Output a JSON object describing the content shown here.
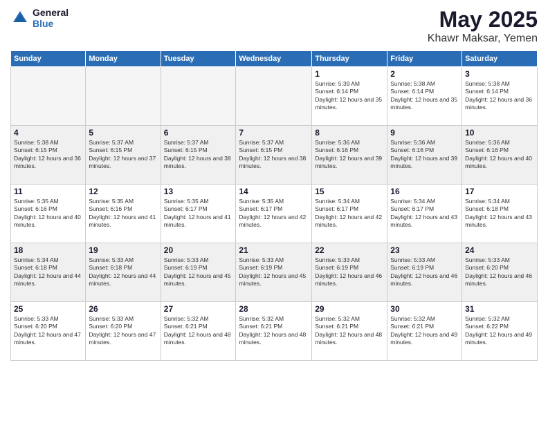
{
  "logo": {
    "general": "General",
    "blue": "Blue"
  },
  "title": "May 2025",
  "subtitle": "Khawr Maksar, Yemen",
  "days_of_week": [
    "Sunday",
    "Monday",
    "Tuesday",
    "Wednesday",
    "Thursday",
    "Friday",
    "Saturday"
  ],
  "weeks": [
    [
      {
        "day": "",
        "empty": true
      },
      {
        "day": "",
        "empty": true
      },
      {
        "day": "",
        "empty": true
      },
      {
        "day": "",
        "empty": true
      },
      {
        "day": "1",
        "sunrise": "5:39 AM",
        "sunset": "6:14 PM",
        "daylight": "12 hours and 35 minutes."
      },
      {
        "day": "2",
        "sunrise": "5:38 AM",
        "sunset": "6:14 PM",
        "daylight": "12 hours and 35 minutes."
      },
      {
        "day": "3",
        "sunrise": "5:38 AM",
        "sunset": "6:14 PM",
        "daylight": "12 hours and 36 minutes."
      }
    ],
    [
      {
        "day": "4",
        "sunrise": "5:38 AM",
        "sunset": "6:15 PM",
        "daylight": "12 hours and 36 minutes."
      },
      {
        "day": "5",
        "sunrise": "5:37 AM",
        "sunset": "6:15 PM",
        "daylight": "12 hours and 37 minutes."
      },
      {
        "day": "6",
        "sunrise": "5:37 AM",
        "sunset": "6:15 PM",
        "daylight": "12 hours and 38 minutes."
      },
      {
        "day": "7",
        "sunrise": "5:37 AM",
        "sunset": "6:15 PM",
        "daylight": "12 hours and 38 minutes."
      },
      {
        "day": "8",
        "sunrise": "5:36 AM",
        "sunset": "6:16 PM",
        "daylight": "12 hours and 39 minutes."
      },
      {
        "day": "9",
        "sunrise": "5:36 AM",
        "sunset": "6:16 PM",
        "daylight": "12 hours and 39 minutes."
      },
      {
        "day": "10",
        "sunrise": "5:36 AM",
        "sunset": "6:16 PM",
        "daylight": "12 hours and 40 minutes."
      }
    ],
    [
      {
        "day": "11",
        "sunrise": "5:35 AM",
        "sunset": "6:16 PM",
        "daylight": "12 hours and 40 minutes."
      },
      {
        "day": "12",
        "sunrise": "5:35 AM",
        "sunset": "6:16 PM",
        "daylight": "12 hours and 41 minutes."
      },
      {
        "day": "13",
        "sunrise": "5:35 AM",
        "sunset": "6:17 PM",
        "daylight": "12 hours and 41 minutes."
      },
      {
        "day": "14",
        "sunrise": "5:35 AM",
        "sunset": "6:17 PM",
        "daylight": "12 hours and 42 minutes."
      },
      {
        "day": "15",
        "sunrise": "5:34 AM",
        "sunset": "6:17 PM",
        "daylight": "12 hours and 42 minutes."
      },
      {
        "day": "16",
        "sunrise": "5:34 AM",
        "sunset": "6:17 PM",
        "daylight": "12 hours and 43 minutes."
      },
      {
        "day": "17",
        "sunrise": "5:34 AM",
        "sunset": "6:18 PM",
        "daylight": "12 hours and 43 minutes."
      }
    ],
    [
      {
        "day": "18",
        "sunrise": "5:34 AM",
        "sunset": "6:18 PM",
        "daylight": "12 hours and 44 minutes."
      },
      {
        "day": "19",
        "sunrise": "5:33 AM",
        "sunset": "6:18 PM",
        "daylight": "12 hours and 44 minutes."
      },
      {
        "day": "20",
        "sunrise": "5:33 AM",
        "sunset": "6:19 PM",
        "daylight": "12 hours and 45 minutes."
      },
      {
        "day": "21",
        "sunrise": "5:33 AM",
        "sunset": "6:19 PM",
        "daylight": "12 hours and 45 minutes."
      },
      {
        "day": "22",
        "sunrise": "5:33 AM",
        "sunset": "6:19 PM",
        "daylight": "12 hours and 46 minutes."
      },
      {
        "day": "23",
        "sunrise": "5:33 AM",
        "sunset": "6:19 PM",
        "daylight": "12 hours and 46 minutes."
      },
      {
        "day": "24",
        "sunrise": "5:33 AM",
        "sunset": "6:20 PM",
        "daylight": "12 hours and 46 minutes."
      }
    ],
    [
      {
        "day": "25",
        "sunrise": "5:33 AM",
        "sunset": "6:20 PM",
        "daylight": "12 hours and 47 minutes."
      },
      {
        "day": "26",
        "sunrise": "5:33 AM",
        "sunset": "6:20 PM",
        "daylight": "12 hours and 47 minutes."
      },
      {
        "day": "27",
        "sunrise": "5:32 AM",
        "sunset": "6:21 PM",
        "daylight": "12 hours and 48 minutes."
      },
      {
        "day": "28",
        "sunrise": "5:32 AM",
        "sunset": "6:21 PM",
        "daylight": "12 hours and 48 minutes."
      },
      {
        "day": "29",
        "sunrise": "5:32 AM",
        "sunset": "6:21 PM",
        "daylight": "12 hours and 48 minutes."
      },
      {
        "day": "30",
        "sunrise": "5:32 AM",
        "sunset": "6:21 PM",
        "daylight": "12 hours and 49 minutes."
      },
      {
        "day": "31",
        "sunrise": "5:32 AM",
        "sunset": "6:22 PM",
        "daylight": "12 hours and 49 minutes."
      }
    ]
  ]
}
